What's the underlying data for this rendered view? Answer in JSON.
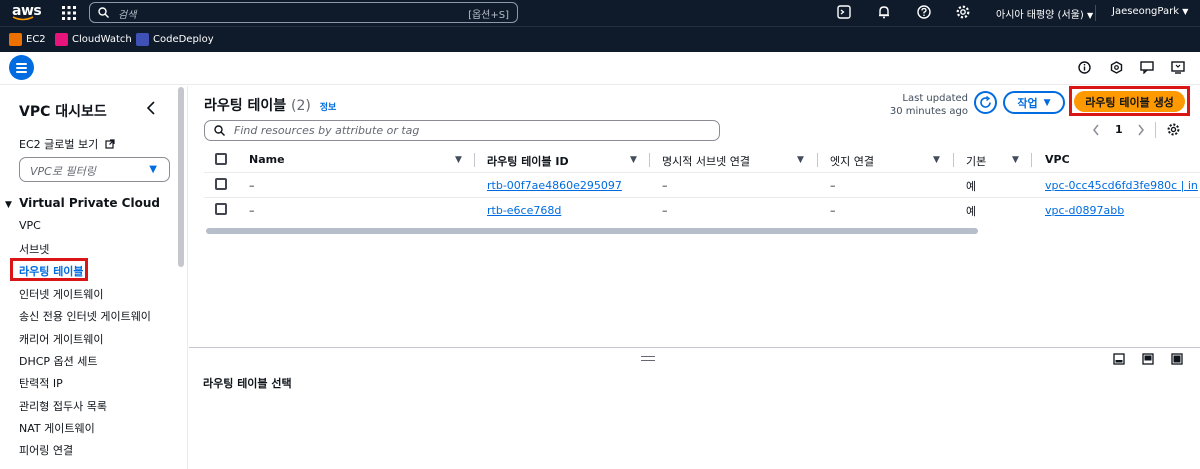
{
  "topnav": {
    "logo": "aws",
    "search_placeholder": "검색",
    "search_shortcut": "[옵션+S]",
    "region": "아시아 태평양 (서울)",
    "user": "JaeseongPark"
  },
  "bookmarks": [
    {
      "label": "EC2",
      "color": "#ed7100"
    },
    {
      "label": "CloudWatch",
      "color": "#e7157b"
    },
    {
      "label": "CodeDeploy",
      "color": "#3f51b5"
    }
  ],
  "sidebar": {
    "title": "VPC 대시보드",
    "ec2_global": "EC2 글로벌 보기",
    "filter_placeholder": "VPC로 필터링",
    "section": "Virtual Private Cloud",
    "items": [
      "VPC",
      "서브넷",
      "라우팅 테이블",
      "인터넷 게이트웨이",
      "송신 전용 인터넷 게이트웨이",
      "캐리어 게이트웨이",
      "DHCP 옵션 세트",
      "탄력적 IP",
      "관리형 접두사 목록",
      "NAT 게이트웨이",
      "피어링 연결"
    ],
    "active_item": "라우팅 테이블"
  },
  "main": {
    "title": "라우팅 테이블",
    "count": "(2)",
    "info": "정보",
    "last_updated_label": "Last updated",
    "last_updated_value": "30 minutes ago",
    "actions_label": "작업",
    "create_label": "라우팅 테이블 생성",
    "find_placeholder": "Find resources by attribute or tag",
    "page": "1",
    "columns": [
      "Name",
      "라우팅 테이블 ID",
      "명시적 서브넷 연결",
      "엣지 연결",
      "기본",
      "VPC"
    ],
    "rows": [
      {
        "name": "–",
        "id": "rtb-00f7ae4860e295097",
        "subnet": "–",
        "edge": "–",
        "main": "예",
        "vpc": "vpc-0cc45cd6fd3fe980c | in"
      },
      {
        "name": "–",
        "id": "rtb-e6ce768d",
        "subnet": "–",
        "edge": "–",
        "main": "예",
        "vpc": "vpc-d0897abb"
      }
    ],
    "lower_panel_title": "라우팅 테이블 선택"
  },
  "colors": {
    "nav_bg": "#0f1b2a",
    "accent": "#006ce0",
    "primary_button": "#ff9900",
    "highlight": "#d91515"
  }
}
